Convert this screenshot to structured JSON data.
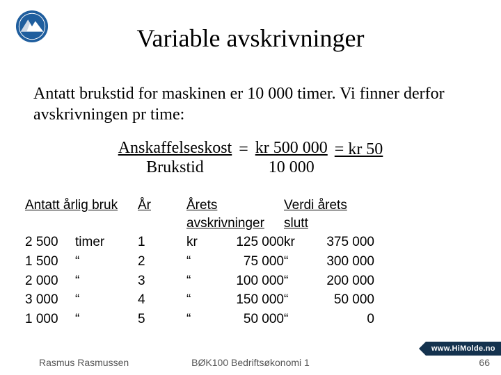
{
  "logo": {
    "name": "mountain-logo"
  },
  "title": "Variable avskrivninger",
  "intro": "Antatt brukstid for maskinen er 10 000 timer. Vi finner derfor avskrivningen pr time:",
  "formula": {
    "lhs_num": "Anskaffelseskost",
    "lhs_den": "Brukstid",
    "mid_num": "kr  500 000",
    "mid_den": "10 000",
    "rhs": "= kr  50"
  },
  "table": {
    "headers": {
      "usage": "Antatt årlig bruk",
      "year": "År",
      "depr": "Årets avskrivninger",
      "endval": "Verdi årets slutt"
    },
    "rows": [
      {
        "usage_n": "2 500",
        "usage_u": "timer",
        "year": "1",
        "depr_c": "kr",
        "depr_v": "125 000",
        "end_c": "kr",
        "end_v": "375 000"
      },
      {
        "usage_n": "1 500",
        "usage_u": "“",
        "year": "2",
        "depr_c": "“",
        "depr_v": "75 000",
        "end_c": "“",
        "end_v": "300 000"
      },
      {
        "usage_n": "2 000",
        "usage_u": "“",
        "year": "3",
        "depr_c": "“",
        "depr_v": "100 000",
        "end_c": "“",
        "end_v": "200 000"
      },
      {
        "usage_n": "3 000",
        "usage_u": "“",
        "year": "4",
        "depr_c": "“",
        "depr_v": "150 000",
        "end_c": "“",
        "end_v": "50 000"
      },
      {
        "usage_n": "1 000",
        "usage_u": "“",
        "year": "5",
        "depr_c": "“",
        "depr_v": "50 000",
        "end_c": "“",
        "end_v": "0"
      }
    ]
  },
  "footer": {
    "author": "Rasmus Rasmussen",
    "course": "BØK100 Bedriftsøkonomi 1",
    "page": "66",
    "branding": "www.HiMolde.no"
  }
}
